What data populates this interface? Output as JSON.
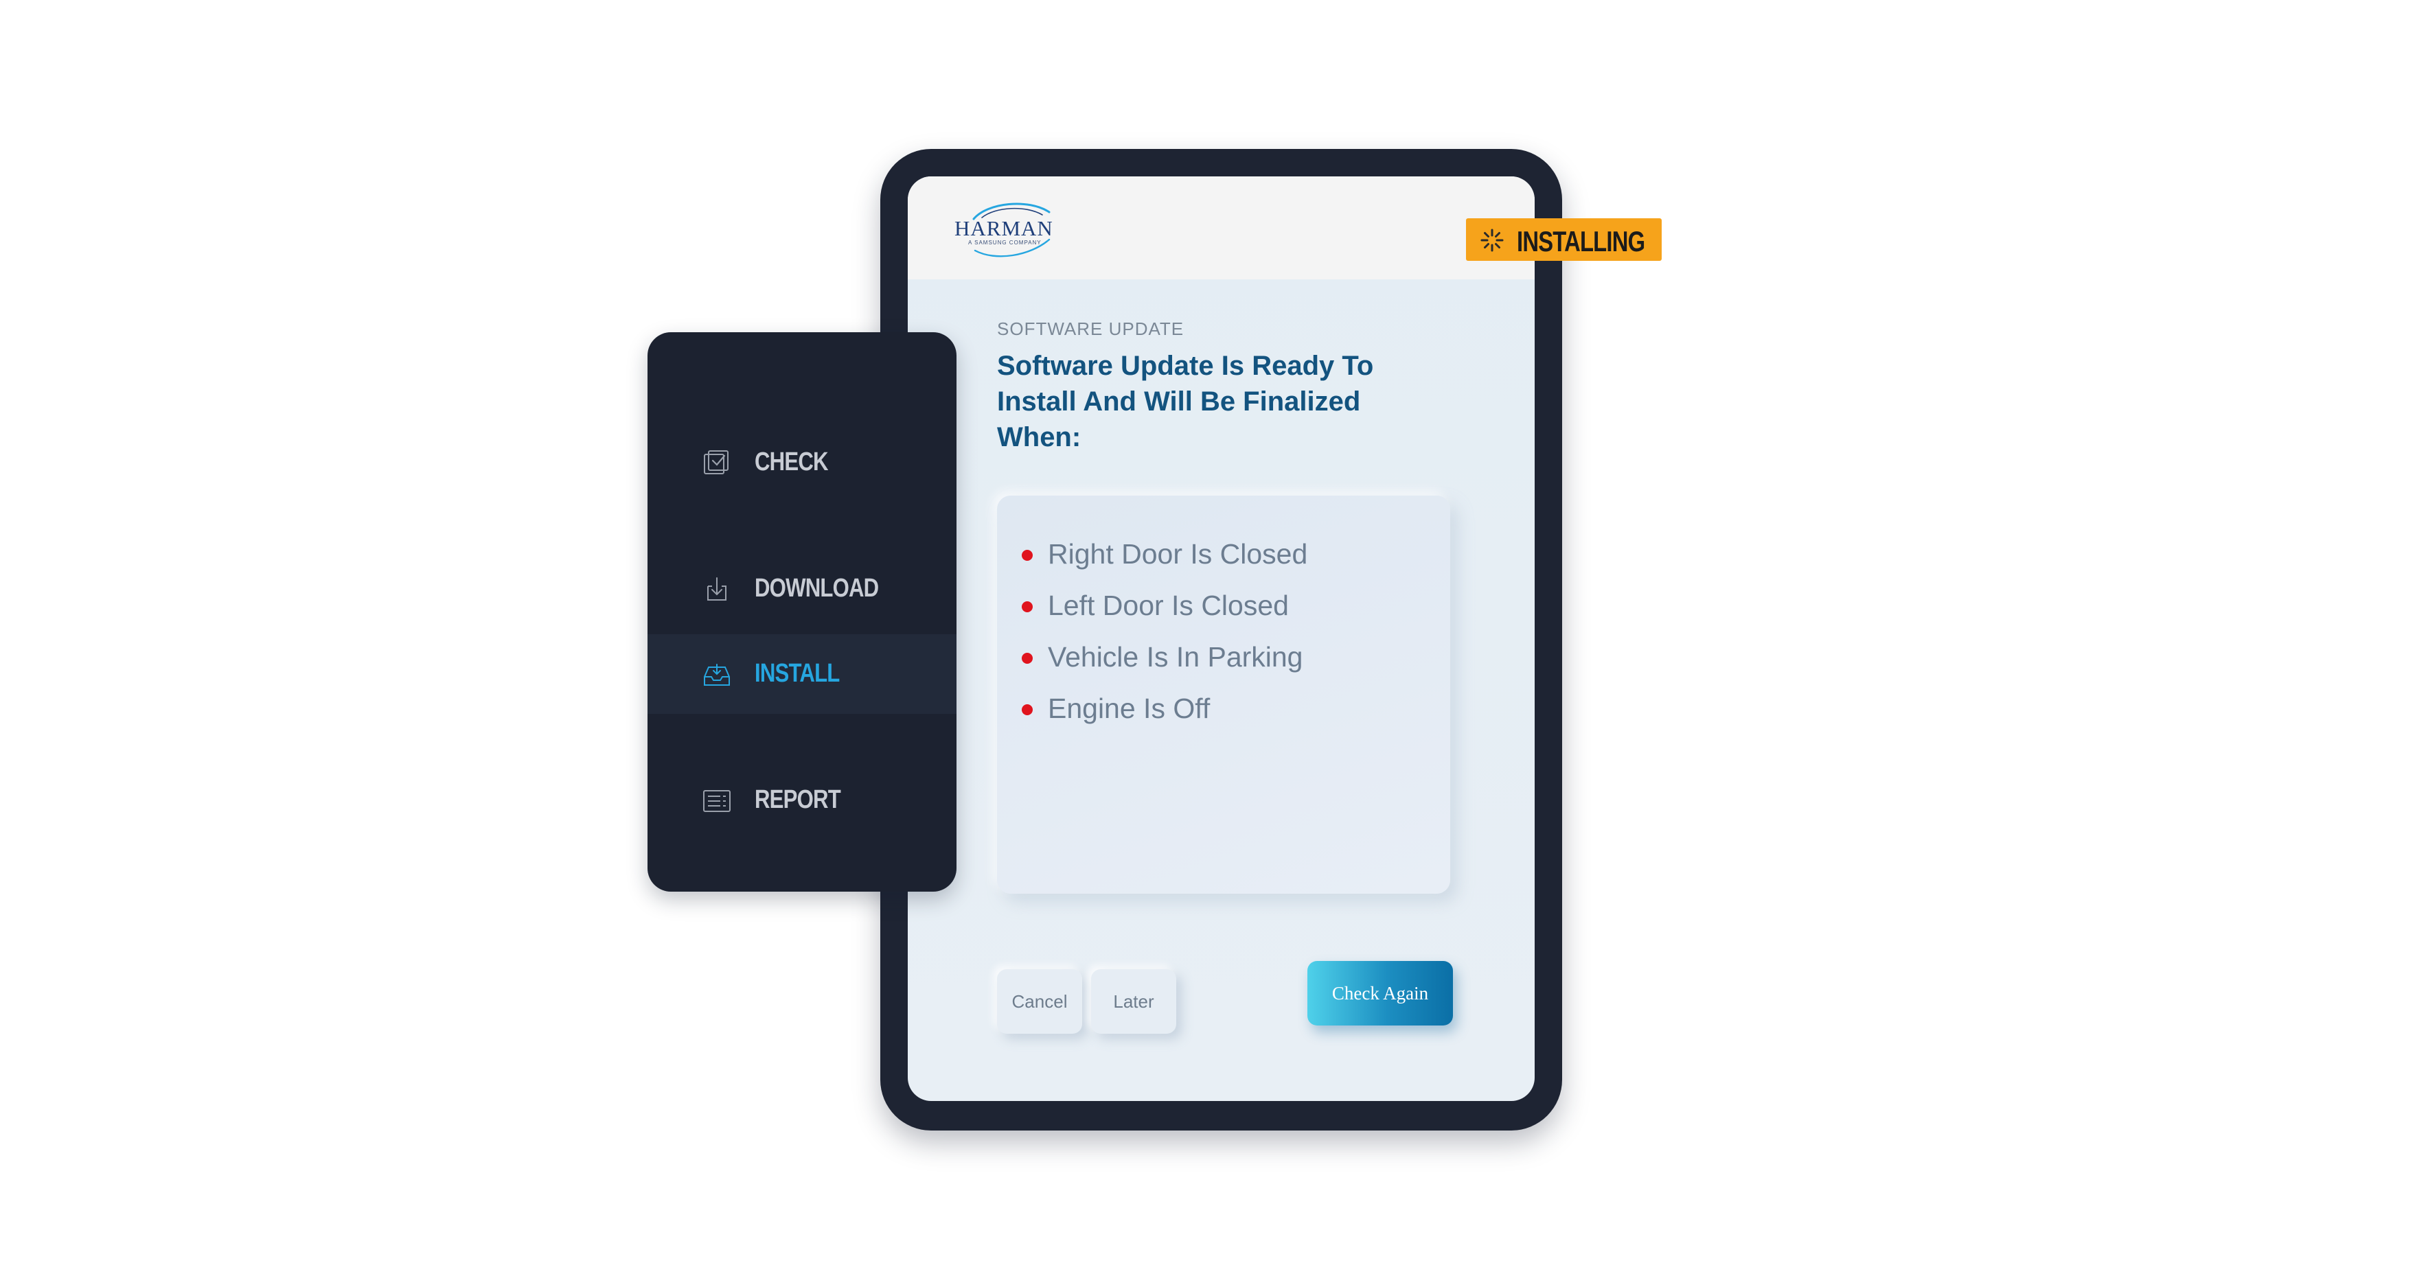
{
  "brand": {
    "name": "HARMAN",
    "tagline": "A SAMSUNG COMPANY",
    "logo_color": "#1f3f7a",
    "swoosh_color": "#26a6e0"
  },
  "status_badge": {
    "label": "INSTALLING",
    "icon": "spinner-icon",
    "color": "#f6a31b"
  },
  "sidebar": {
    "items": [
      {
        "label": "CHECK",
        "icon": "checklist-icon",
        "active": false
      },
      {
        "label": "DOWNLOAD",
        "icon": "download-icon",
        "active": false
      },
      {
        "label": "INSTALL",
        "icon": "install-tray-icon",
        "active": true
      },
      {
        "label": "REPORT",
        "icon": "report-list-icon",
        "active": false
      }
    ],
    "active_color": "#26a6e0"
  },
  "content": {
    "eyebrow": "SOFTWARE UPDATE",
    "headline": "Software Update Is Ready To Install And Will Be Finalized When:",
    "conditions": [
      "Right Door Is Closed",
      "Left Door Is Closed",
      "Vehicle Is In Parking",
      "Engine Is Off"
    ],
    "bullet_color": "#e0141e"
  },
  "actions": {
    "cancel_label": "Cancel",
    "later_label": "Later",
    "check_again_label": "Check Again"
  }
}
